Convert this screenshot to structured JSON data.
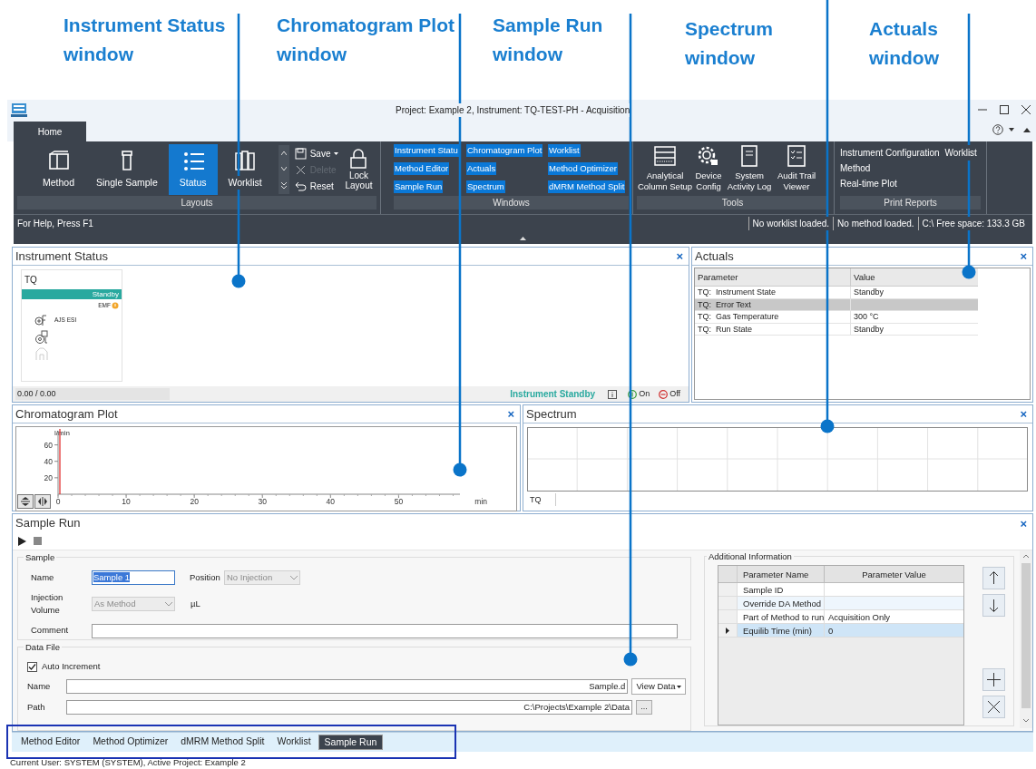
{
  "callouts": [
    {
      "label": "Instrument Status window"
    },
    {
      "label": "Chromatogram Plot window"
    },
    {
      "label": "Sample Run window"
    },
    {
      "label": "Spectrum window"
    },
    {
      "label": "Actuals window"
    }
  ],
  "window": {
    "title": "Project: Example 2, Instrument: TQ-TEST-PH - Acquisition"
  },
  "ribbon": {
    "tabs": [
      {
        "label": "Home",
        "selected": true
      }
    ],
    "layouts": {
      "label": "Layouts",
      "buttons": [
        {
          "label": "Method",
          "selected": false
        },
        {
          "label": "Single Sample",
          "selected": false
        },
        {
          "label": "Status",
          "selected": true
        },
        {
          "label": "Worklist",
          "selected": false
        }
      ],
      "actions": [
        {
          "label": "Save",
          "disabled": false
        },
        {
          "label": "Delete",
          "disabled": true
        },
        {
          "label": "Reset",
          "disabled": false
        }
      ],
      "lock": "Lock Layout"
    },
    "windows": {
      "label": "Windows",
      "items": [
        {
          "label": "Instrument Statu",
          "selected": true
        },
        {
          "label": "Method Editor",
          "selected": true
        },
        {
          "label": "Sample Run",
          "selected": true
        },
        {
          "label": "Chromatogram Plot",
          "selected": true
        },
        {
          "label": "Actuals",
          "selected": true
        },
        {
          "label": "Spectrum",
          "selected": true
        },
        {
          "label": "Worklist",
          "selected": true
        },
        {
          "label": "Method Optimizer",
          "selected": true
        },
        {
          "label": "dMRM Method Split",
          "selected": true
        }
      ]
    },
    "tools": {
      "label": "Tools",
      "items": [
        {
          "label": "Analytical Column Setup"
        },
        {
          "label": "Device Config"
        },
        {
          "label": "System Activity Log"
        },
        {
          "label": "Audit Trail Viewer"
        }
      ]
    },
    "print_reports": {
      "label": "Print Reports",
      "items": [
        "Instrument Configuration",
        "Worklist",
        "Method",
        "Real-time Plot"
      ]
    }
  },
  "status_strip": {
    "help": "For Help, Press F1",
    "segments": [
      "No worklist loaded.",
      "No method loaded.",
      "C:\\ Free space: 133.3 GB"
    ]
  },
  "instrument_status": {
    "title": "Instrument Status",
    "close": "×",
    "module": {
      "name": "TQ",
      "state": "Standby",
      "emf": "EMF",
      "source": "AJS ESI"
    },
    "progress": "0.00 / 0.00",
    "status": "Instrument Standby",
    "on": "On",
    "off": "Off"
  },
  "actuals": {
    "title": "Actuals",
    "close": "×",
    "columns": [
      "Parameter",
      "Value"
    ],
    "rows": [
      {
        "cells": [
          "TQ:  Instrument State",
          "Standby"
        ],
        "selected": false
      },
      {
        "cells": [
          "TQ:  Error Text",
          ""
        ],
        "selected": true
      },
      {
        "cells": [
          "TQ:  Gas Temperature",
          "300 °C"
        ],
        "selected": false
      },
      {
        "cells": [
          "TQ:  Run State",
          "Standby"
        ],
        "selected": false
      }
    ]
  },
  "chromatogram": {
    "title": "Chromatogram Plot",
    "close": "×",
    "chart_data": {
      "type": "line",
      "xlabel": "min",
      "ylabel": "l/min",
      "xlim": [
        0,
        59
      ],
      "ylim": [
        0,
        75
      ],
      "xticks": [
        0,
        10,
        20,
        30,
        40,
        50
      ],
      "yticks": [
        20,
        40,
        60
      ]
    }
  },
  "spectrum": {
    "title": "Spectrum",
    "close": "×",
    "tab": "TQ"
  },
  "sample_run": {
    "title": "Sample Run",
    "close": "×",
    "sample": {
      "label": "Sample",
      "name_label": "Name",
      "name": "Sample 1",
      "name_focused": true,
      "position_label": "Position",
      "position": "No Injection",
      "position_disabled": true,
      "volume_label": "Injection Volume",
      "volume": "As Method",
      "volume_disabled": true,
      "unit": "µL",
      "comment_label": "Comment"
    },
    "data_file": {
      "label": "Data File",
      "auto_increment": {
        "label": "Auto Increment",
        "checked": true
      },
      "name_label": "Name",
      "name": "Sample.d",
      "view_data": "View Data",
      "path_label": "Path",
      "path": "C:\\Projects\\Example 2\\Data",
      "browse": "..."
    },
    "additional": {
      "label": "Additional Information",
      "columns": [
        "Parameter Name",
        "Parameter Value"
      ],
      "rows": [
        {
          "cells": [
            "Sample ID",
            ""
          ],
          "selected": false
        },
        {
          "cells": [
            "Override DA Method",
            ""
          ],
          "selected": false
        },
        {
          "cells": [
            "Part of Method to run",
            "Acquisition Only"
          ],
          "selected": false
        },
        {
          "cells": [
            "Equilib Time (min)",
            "0"
          ],
          "selected": true
        }
      ]
    }
  },
  "document_tabs": [
    {
      "label": "Method Editor",
      "selected": false
    },
    {
      "label": "Method Optimizer",
      "selected": false
    },
    {
      "label": "dMRM Method Split",
      "selected": false
    },
    {
      "label": "Worklist",
      "selected": false
    },
    {
      "label": "Sample Run",
      "selected": true
    }
  ],
  "status_bar": "Current User: SYSTEM (SYSTEM), Active Project: Example 2"
}
